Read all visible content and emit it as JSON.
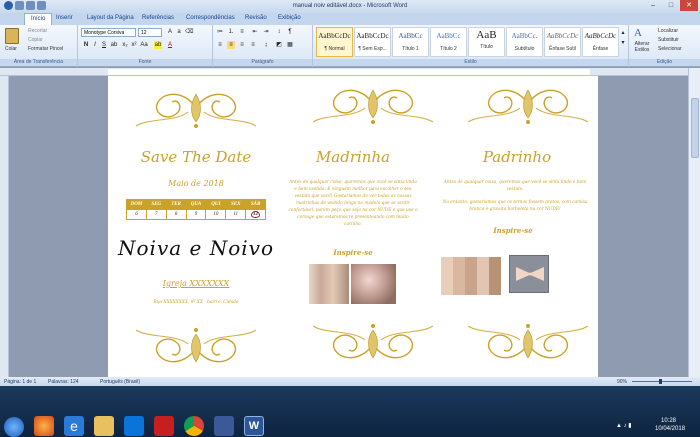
{
  "window": {
    "title": "manual noiv editável.docx - Microsoft Word",
    "min": "–",
    "max": "□",
    "close": "✕"
  },
  "tabs": [
    "Início",
    "Inserir",
    "Layout da Página",
    "Referências",
    "Correspondências",
    "Revisão",
    "Exibição"
  ],
  "ribbon": {
    "clipboard": {
      "paste": "Colar",
      "cut": "Recortar",
      "copy": "Copiar",
      "format_painter": "Formatar Pincel",
      "group": "Área de Transferência"
    },
    "font": {
      "name": "Monotype Corsiva",
      "size": "12",
      "group": "Fonte"
    },
    "paragraph": {
      "group": "Parágrafo"
    },
    "styles": {
      "items": [
        {
          "sample": "AaBbCcDc",
          "name": "¶ Normal"
        },
        {
          "sample": "AaBbCcDc",
          "name": "¶ Sem Esp..."
        },
        {
          "sample": "AaBbCc",
          "name": "Título 1"
        },
        {
          "sample": "AaBbCc",
          "name": "Título 2"
        },
        {
          "sample": "AaB",
          "name": "Título"
        },
        {
          "sample": "AaBbCc.",
          "name": "Subtítulo"
        },
        {
          "sample": "AaBbCcDc",
          "name": "Ênfase Sutil"
        },
        {
          "sample": "AaBbCcDc",
          "name": "Ênfase"
        }
      ],
      "change": "Alterar Estilos",
      "group": "Estilo"
    },
    "editing": {
      "find": "Localizar",
      "replace": "Substituir",
      "select": "Selecionar",
      "group": "Edição"
    }
  },
  "doc": {
    "col1": {
      "title": "Save The Date",
      "month": "Maio de 2018",
      "days_h": [
        "DOM",
        "SEG",
        "TER",
        "QUA",
        "QUI",
        "SEX",
        "SÁB"
      ],
      "days": [
        "6",
        "7",
        "8",
        "9",
        "10",
        "11",
        "12"
      ],
      "names": "Noiva e Noivo",
      "church": "Igreja XXXXXXX",
      "address": "Rua XXXXXXXX, nº XX - bairro, Cidade"
    },
    "col2": {
      "title": "Madrinha",
      "text": "Antes de qualquer coisa, queremos que você se sinta linda e bem vestida. E ninguém melhor para escolher o seu vestido que você! Gostaríamos de ver todas as nossas madrinhas de vestido longo no modelo que se sentir confortável, porém peço que seja na cor NUDE e que use o corsage que estaremos te presenteando com muito carinho.",
      "inspire": "Inspire-se"
    },
    "col3": {
      "title": "Padrinho",
      "text1": "Antes de qualquer coisa, queremos que você se sinta lindo e bem vestido.",
      "text2": "No entanto, gostaríamos que os ternos fossem pretos, com camisa branca e gravata borboleta na cor NUDE!",
      "inspire": "Inspire-se"
    }
  },
  "status": {
    "page": "Página: 1 de 1",
    "words": "Palavras: 124",
    "lang": "Português (Brasil)",
    "zoom": "90%"
  },
  "clock": {
    "time": "10:28",
    "date": "10/04/2018"
  },
  "colors": {
    "gold": "#c9a227",
    "nude1": "#e8cdb9",
    "nude2": "#d9b7a0",
    "nude3": "#c9a48b",
    "nude4": "#e3c5b3",
    "nude5": "#b89274"
  }
}
